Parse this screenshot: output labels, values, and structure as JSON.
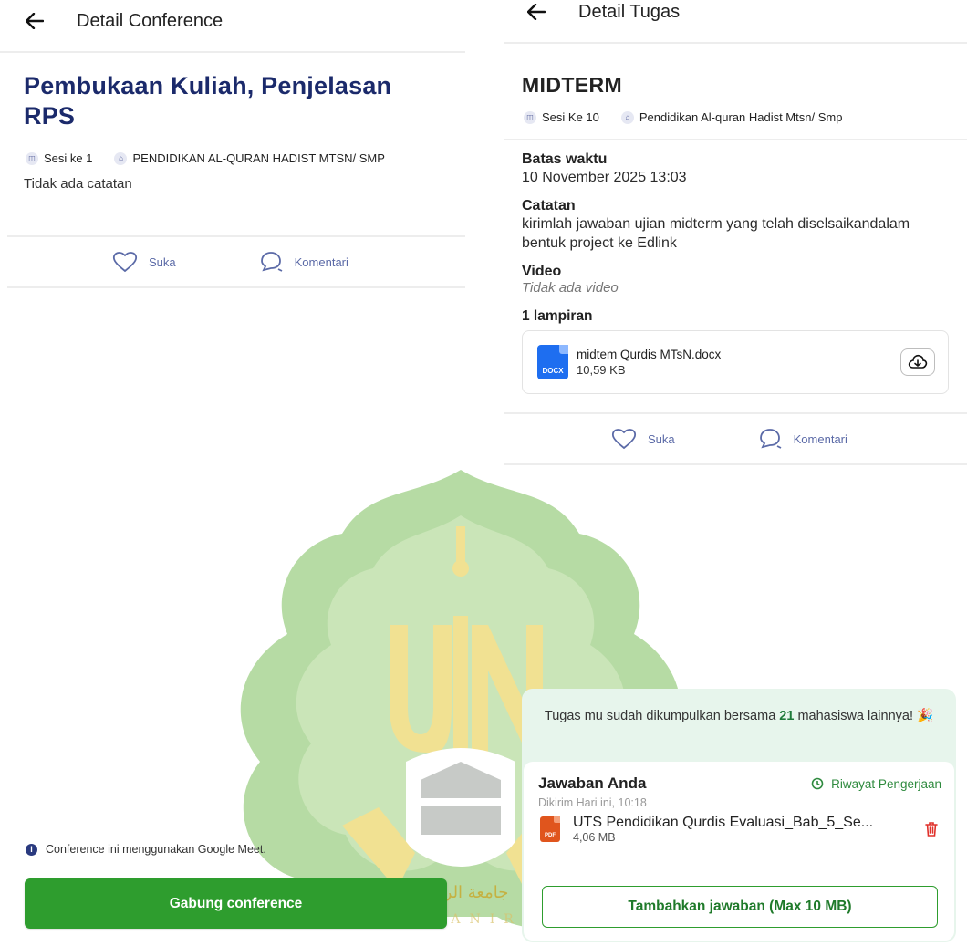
{
  "left": {
    "appbar_title": "Detail Conference",
    "title": "Pembukaan Kuliah, Penjelasan RPS",
    "session": "Sesi ke 1",
    "course": "PENDIDIKAN AL-QURAN HADIST MTSN/ SMP",
    "note": "Tidak ada catatan",
    "like_label": "Suka",
    "comment_label": "Komentari",
    "info_text": "Conference ini menggunakan Google Meet.",
    "join_label": "Gabung conference"
  },
  "right": {
    "appbar_title": "Detail Tugas",
    "title": "MIDTERM",
    "session": "Sesi Ke 10",
    "course": "Pendidikan Al-quran Hadist Mtsn/ Smp",
    "deadline_label": "Batas waktu",
    "deadline_value": "10 November 2025 13:03",
    "note_label": "Catatan",
    "note_value": "kirimlah jawaban ujian midterm yang telah diselsaikandalam bentuk project ke Edlink",
    "video_label": "Video",
    "video_value": "Tidak ada video",
    "attachments_label": "1 lampiran",
    "attachment": {
      "name": "midtem Qurdis MTsN.docx",
      "size": "10,59 KB",
      "type": "DOCX"
    },
    "like_label": "Suka",
    "comment_label": "Komentari",
    "submission_msg_before": "Tugas mu sudah dikumpulkan bersama",
    "submission_count": "21",
    "submission_msg_after": "mahasiswa lainnya! 🎉",
    "answer_title": "Jawaban Anda",
    "history_label": "Riwayat Pengerjaan",
    "sent_time": "Dikirim Hari ini, 10:18",
    "answer_file": {
      "name": "UTS Pendidikan Qurdis Evaluasi_Bab_5_Se...",
      "size": "4,06 MB",
      "type": "PDF"
    },
    "add_answer_label": "Tambahkan jawaban (Max 10 MB)"
  },
  "watermark": {
    "letters": "UIN",
    "arabic": "جامعة الرانري",
    "sub": "AR-RANIRY"
  },
  "colors": {
    "title_blue": "#1b2a6b",
    "accent_green": "#2e9d2e",
    "link_blue": "#5b6aa7",
    "panel_green": "#e7f5ec"
  }
}
